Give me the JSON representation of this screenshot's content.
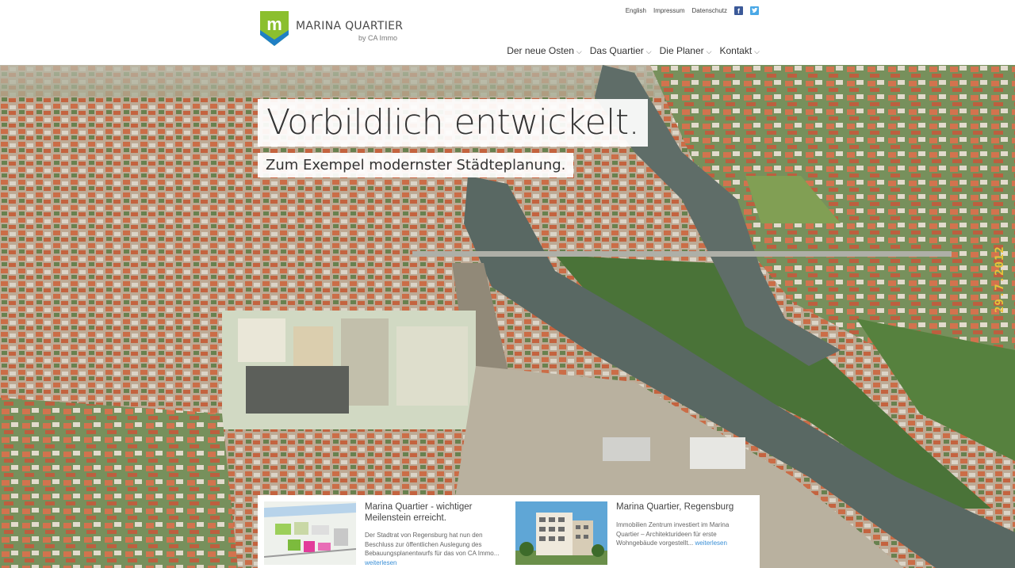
{
  "brand": {
    "name": "MARINA QUARTIER",
    "sub": "by CA Immo",
    "badge_letter": "m"
  },
  "util_nav": {
    "english": "English",
    "impressum": "Impressum",
    "datenschutz": "Datenschutz"
  },
  "main_nav": [
    {
      "label": "Der neue Osten"
    },
    {
      "label": "Das Quartier"
    },
    {
      "label": "Die Planer"
    },
    {
      "label": "Kontakt"
    }
  ],
  "hero": {
    "headline": "Vorbildlich entwickelt.",
    "subline": "Zum Exempel modernster Städteplanung.",
    "stamp": "29.7.2012"
  },
  "news": [
    {
      "title": "Marina Quartier - wichtiger Meilenstein erreicht.",
      "text": "Der Stadtrat von Regensburg hat nun den Beschluss zur öffentlichen Auslegung des Bebauungsplanentwurfs für das von CA Immo...",
      "more": "weiterlesen"
    },
    {
      "title": "Marina Quartier, Regensburg",
      "text": "Immobilien Zentrum investiert im Marina Quartier – Architekturideen für erste Wohngebäude vorgestellt...",
      "more": "weiterlesen"
    }
  ],
  "colors": {
    "brand_green": "#8bbf2e",
    "brand_blue": "#1f7fc4",
    "link": "#3a8fd6",
    "facebook": "#3b5998",
    "twitter": "#4aa8e6"
  },
  "icons": {
    "facebook": "facebook-icon",
    "twitter": "twitter-icon",
    "chevron": "chevron-down-icon"
  }
}
